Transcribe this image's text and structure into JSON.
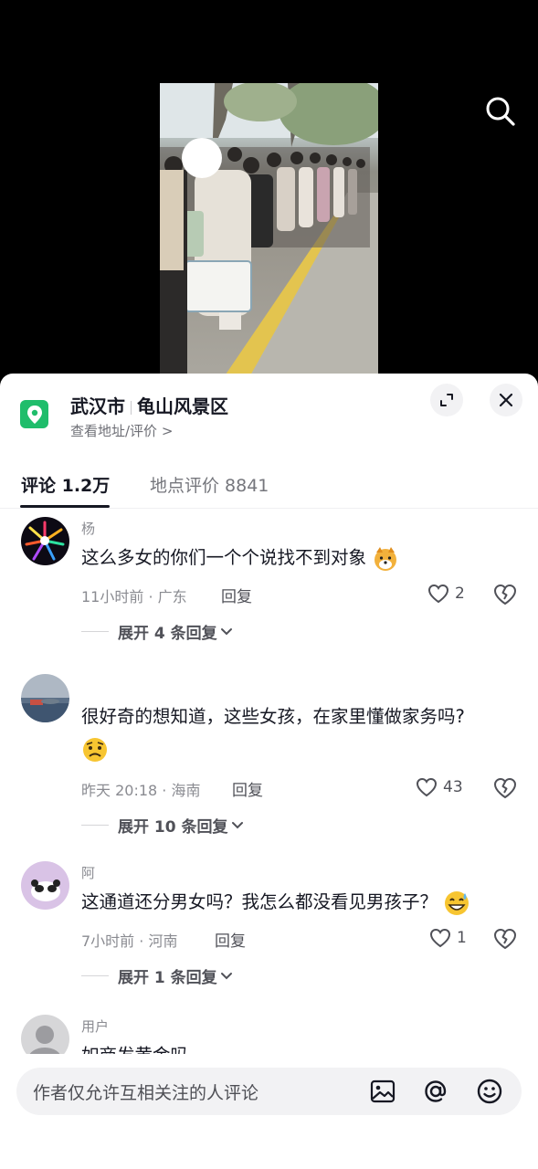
{
  "location": {
    "city": "武汉市",
    "place": "龟山风景区",
    "subtitle": "查看地址/评价 >"
  },
  "tabs": [
    {
      "label": "评论 1.2万"
    },
    {
      "label": "地点评价 8841"
    }
  ],
  "comments": [
    {
      "name": "杨",
      "text": "这么多女的你们一个个说找不到对象",
      "time_location": "11小时前 · 广东",
      "reply_label": "回复",
      "likes": "2",
      "expand_label": "展开 4 条回复"
    },
    {
      "name": "",
      "text": "很好奇的想知道，这些女孩，在家里懂做家务吗?",
      "time_location": "昨天 20:18 · 海南",
      "reply_label": "回复",
      "likes": "43",
      "expand_label": "展开 10 条回复"
    },
    {
      "name": "阿",
      "text": "这通道还分男女吗？我怎么都没看见男孩子？",
      "time_location": "7小时前 · 河南",
      "reply_label": "回复",
      "likes": "1",
      "expand_label": "展开 1 条回复"
    },
    {
      "name": "用户",
      "text": "如商发黄金吗"
    }
  ],
  "input": {
    "placeholder": "作者仅允许互相关注的人评论"
  },
  "icons": {
    "search": "search-icon",
    "location": "map-pin-icon",
    "expand": "expand-icon",
    "close": "close-icon",
    "like": "heart-icon",
    "dislike": "broken-heart-icon",
    "image": "image-icon",
    "mention": "at-icon",
    "emoji": "smiley-icon"
  },
  "colors": {
    "accent_green": "#1fbd6b",
    "text_primary": "#161823",
    "text_secondary": "#8a8b91"
  }
}
